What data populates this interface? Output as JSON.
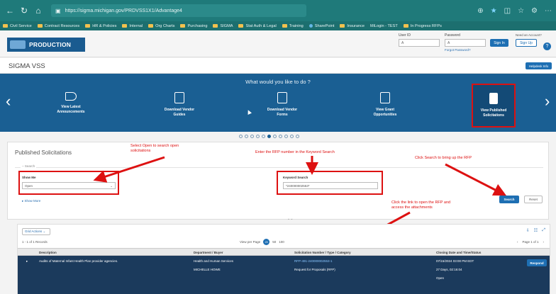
{
  "browser": {
    "url": "https://sigma.michigan.gov/PRDVSS1X1/Advantage4",
    "bookmarks": [
      "Civil Service",
      "Contract Resources",
      "HR & Policies",
      "Internal",
      "Org Charts",
      "Purchasing",
      "SIGMA",
      "Stat Auth & Legal",
      "Training",
      "SharePoint",
      "Insurance",
      "MiLogin - TEST",
      "In Progress RFPs"
    ]
  },
  "header": {
    "logo_text": "PRODUCTION",
    "user_id_label": "User ID",
    "password_label": "Password",
    "user_id_value": "A",
    "password_value": "A",
    "forgot_password": "Forgot Password?",
    "sign_in": "Sign In",
    "need_account": "Need an Account?",
    "sign_up": "Sign Up",
    "help": "?"
  },
  "vss": {
    "title": "SIGMA VSS",
    "helpdesk": "Helpdesk Info"
  },
  "carousel": {
    "question": "What would you like to do ?",
    "slides": [
      {
        "label1": "View Latest",
        "label2": "Announcements",
        "icon": "megaphone-icon"
      },
      {
        "label1": "Download Vendor",
        "label2": "Guides",
        "icon": "document-icon"
      },
      {
        "label1": "Download Vendor",
        "label2": "Forms",
        "icon": "form-icon"
      },
      {
        "label1": "View Grant",
        "label2": "Opportunities",
        "icon": "grant-icon"
      },
      {
        "label1": "View Published",
        "label2": "Solicitations",
        "icon": "calculator-icon"
      }
    ]
  },
  "search": {
    "panel_title": "Published Solicitations",
    "legend": "Search",
    "show_me_label": "Show Me",
    "show_me_value": "Open",
    "keyword_label": "Keyword Search",
    "keyword_value": "*240000002553*",
    "show_more": "Show More",
    "search_btn": "Search",
    "reset_btn": "Reset"
  },
  "annotations": {
    "a1": "Select Open to search open",
    "a1b": "solicitations",
    "a2": "Enter the RFP number in the Keyword Search",
    "a3": "Click Search to bring up the RFP",
    "a4": "Click the link to open the RFP and",
    "a4b": "access the attachments"
  },
  "results": {
    "grid_actions": "Grid Actions",
    "records": "1 - 1 of 1 Records",
    "view_per_page": "View per Page",
    "per_page_options": [
      "20",
      "50",
      "100"
    ],
    "pager": "Page 1 of 1",
    "columns": [
      "Description",
      "Department / Buyer",
      "Solicitation Number / Type / Category",
      "Closing Date and Time/Status"
    ],
    "row": {
      "description": "Audits of Maternal Infant Health Plan provider agencies.",
      "department": "Health and Human Services",
      "buyer": "MICHELLE HOWE",
      "solicitation": "RFP-491-240000002553-1",
      "type": "Request for Proposals (RFP)",
      "closing": "07/15/2024 03:00 PM EDT",
      "days": "27 Days, 02:16:04",
      "status": "Open",
      "respond": "Respond"
    }
  }
}
